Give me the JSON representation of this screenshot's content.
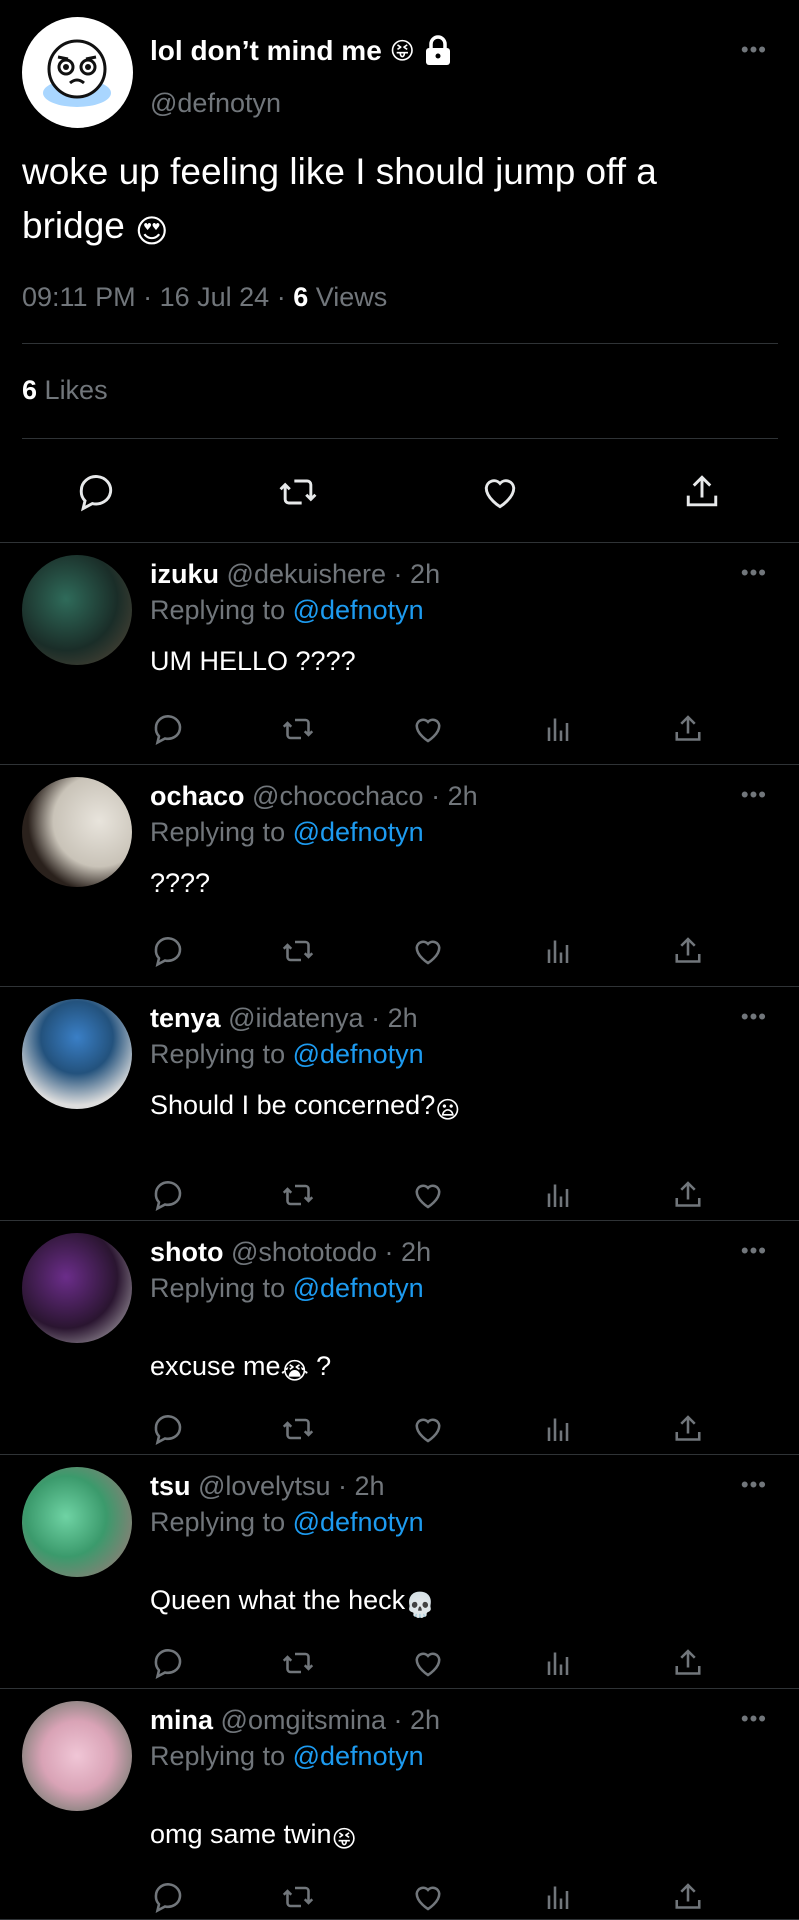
{
  "main": {
    "display_name": "lol don’t mind me",
    "name_emoji": "😝",
    "lock_icon": "lock-icon",
    "handle": "@defnotyn",
    "text": "woke up feeling like I should jump off a bridge",
    "text_emoji": "😍",
    "time": "09:11 PM",
    "date": "16 Jul 24",
    "views_count": "6",
    "views_label": "Views",
    "likes_count": "6",
    "likes_label": "Likes",
    "more": "•••"
  },
  "replies": [
    {
      "name": "izuku",
      "handle": "@dekuishere",
      "time": "2h",
      "replying_prefix": "Replying to",
      "replying_to": "@defnotyn",
      "text": "UM HELLO ????",
      "emoji": ""
    },
    {
      "name": "ochaco",
      "handle": "@chocochaco",
      "time": "2h",
      "replying_prefix": "Replying to",
      "replying_to": "@defnotyn",
      "text": "????",
      "emoji": ""
    },
    {
      "name": "tenya",
      "handle": "@iidatenya",
      "time": "2h",
      "replying_prefix": "Replying to",
      "replying_to": "@defnotyn",
      "text": "Should I be concerned?",
      "emoji": "😦"
    },
    {
      "name": "shoto",
      "handle": "@shototodo",
      "time": "2h",
      "replying_prefix": "Replying to",
      "replying_to": "@defnotyn",
      "text": "excuse me",
      "emoji": "😭",
      "text_suffix": " ?"
    },
    {
      "name": "tsu",
      "handle": "@lovelytsu",
      "time": "2h",
      "replying_prefix": "Replying to",
      "replying_to": "@defnotyn",
      "text": "Queen what the heck",
      "emoji": "💀"
    },
    {
      "name": "mina",
      "handle": "@omgitsmina",
      "time": "2h",
      "replying_prefix": "Replying to",
      "replying_to": "@defnotyn",
      "text": "omg same twin",
      "emoji": "😝"
    }
  ],
  "icons": {
    "reply": "reply-icon",
    "retweet": "retweet-icon",
    "like": "heart-icon",
    "analytics": "analytics-icon",
    "share": "share-icon"
  },
  "colors": {
    "background": "#000000",
    "text": "#e7e9ea",
    "muted": "#71767b",
    "link": "#1d9bf0",
    "divider": "#2f3336"
  }
}
